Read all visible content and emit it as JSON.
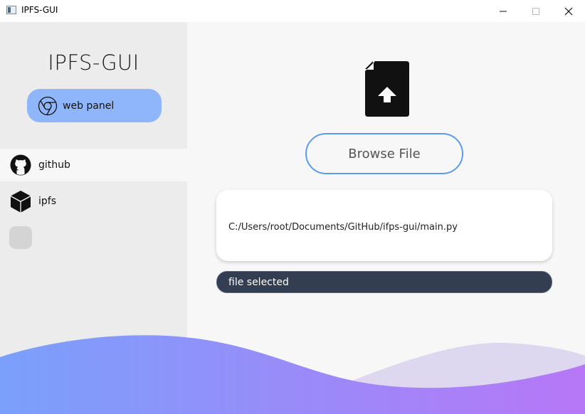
{
  "window": {
    "title": "IPFS-GUI",
    "minimize_glyph": "—",
    "maximize_glyph": "☐",
    "close_glyph": "✕"
  },
  "sidebar": {
    "brand": "IPFS-GUI",
    "web_panel_button": {
      "label": "web panel",
      "icon": "chrome-icon"
    },
    "items": [
      {
        "label": "github",
        "icon": "github-icon",
        "active": true
      },
      {
        "label": "ipfs",
        "icon": "cube-icon",
        "active": false
      }
    ]
  },
  "main": {
    "file_icon": "file-upload-icon",
    "browse_button": "Browse File",
    "selected_path": "C:/Users/root/Documents/GitHub/ifps-gui/main.py",
    "status": "file selected"
  },
  "colors": {
    "web_panel_bg": "#8fb6fb",
    "browse_border": "#5b9bf0",
    "status_bg": "#343e52",
    "wave_start": "#7aa0fb",
    "wave_end": "#b777f7",
    "wave_back": "#ddd8f0"
  }
}
